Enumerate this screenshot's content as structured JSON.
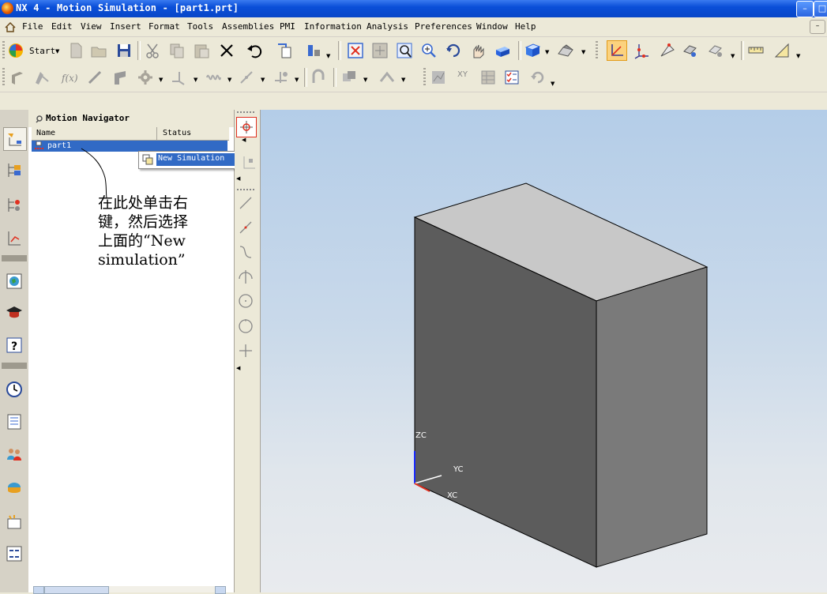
{
  "window": {
    "title": "NX 4 - Motion Simulation - [part1.prt]"
  },
  "menu": [
    "File",
    "Edit",
    "View",
    "Insert",
    "Format",
    "Tools",
    "Assemblies",
    "PMI",
    "Information",
    "Analysis",
    "Preferences",
    "Window",
    "Help"
  ],
  "toolbar": {
    "start_label": "Start",
    "fx_label": "f(x)",
    "xy_label": "XY"
  },
  "navigator": {
    "title": "Motion Navigator",
    "columns": [
      "Name",
      "Status"
    ],
    "rows": [
      {
        "name": "part1",
        "status": ""
      }
    ]
  },
  "context_menu": {
    "items": [
      "New Simulation"
    ]
  },
  "annotation": "在此处单击右\n键，然后选择\n上面的“New\nsimulation”",
  "viewport": {
    "axes": {
      "z": "ZC",
      "y": "YC",
      "x": "XC"
    }
  },
  "colors": {
    "titlebar": "#0a4fd8",
    "selection": "#316ac5",
    "box_top": "#c8c8c8",
    "box_front": "#5c5c5c",
    "box_side": "#7a7a7a"
  },
  "icons": [
    "nx-app-icon",
    "start-icon",
    "new-icon",
    "open-icon",
    "save-icon",
    "cut-icon",
    "copy-icon",
    "paste-icon",
    "delete-icon",
    "undo-icon",
    "fit-icon",
    "zoom-icon",
    "rotate-icon",
    "pan-icon",
    "shaded-box-icon",
    "wcs-icon",
    "help-icon",
    "history-icon",
    "roles-icon"
  ]
}
